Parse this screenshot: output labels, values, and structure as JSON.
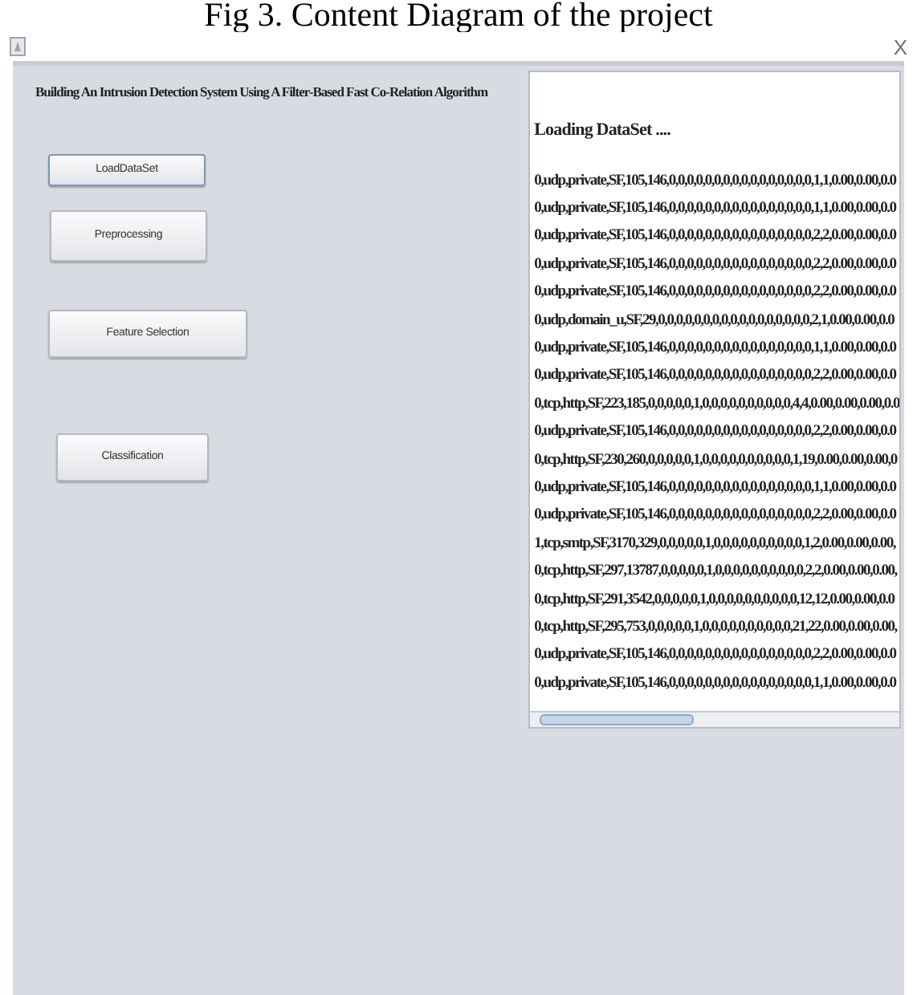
{
  "caption": "Fig 3. Content Diagram of the project",
  "window": {
    "close": "X"
  },
  "title": "Building An Intrusion Detection System Using A Filter-Based Fast Co-Relation Algorithm",
  "buttons": [
    {
      "label": "LoadDataSet",
      "selected": true
    },
    {
      "label": "Preprocessing",
      "selected": false
    },
    {
      "label": "Feature Selection",
      "selected": false
    },
    {
      "label": "Classification",
      "selected": false
    }
  ],
  "output": {
    "heading": "Loading DataSet ....",
    "lines": [
      "0,udp,private,SF,105,146,0,0,0,0,0,0,0,0,0,0,0,0,0,0,0,0,1,1,0.00,0.00,0.0",
      "0,udp,private,SF,105,146,0,0,0,0,0,0,0,0,0,0,0,0,0,0,0,0,1,1,0.00,0.00,0.0",
      "0,udp,private,SF,105,146,0,0,0,0,0,0,0,0,0,0,0,0,0,0,0,0,2,2,0.00,0.00,0.0",
      "0,udp,private,SF,105,146,0,0,0,0,0,0,0,0,0,0,0,0,0,0,0,0,2,2,0.00,0.00,0.0",
      "0,udp,private,SF,105,146,0,0,0,0,0,0,0,0,0,0,0,0,0,0,0,0,2,2,0.00,0.00,0.0",
      "0,udp,domain_u,SF,29,0,0,0,0,0,0,0,0,0,0,0,0,0,0,0,0,0,2,1,0.00,0.00,0.0",
      "0,udp,private,SF,105,146,0,0,0,0,0,0,0,0,0,0,0,0,0,0,0,0,1,1,0.00,0.00,0.0",
      "0,udp,private,SF,105,146,0,0,0,0,0,0,0,0,0,0,0,0,0,0,0,0,2,2,0.00,0.00,0.0",
      "0,tcp,http,SF,223,185,0,0,0,0,0,1,0,0,0,0,0,0,0,0,0,0,4,4,0.00,0.00,0.00,0.0",
      "0,udp,private,SF,105,146,0,0,0,0,0,0,0,0,0,0,0,0,0,0,0,0,2,2,0.00,0.00,0.0",
      "0,tcp,http,SF,230,260,0,0,0,0,0,1,0,0,0,0,0,0,0,0,0,0,1,19,0.00,0.00,0.00,0",
      "0,udp,private,SF,105,146,0,0,0,0,0,0,0,0,0,0,0,0,0,0,0,0,1,1,0.00,0.00,0.0",
      "0,udp,private,SF,105,146,0,0,0,0,0,0,0,0,0,0,0,0,0,0,0,0,2,2,0.00,0.00,0.0",
      "1,tcp,smtp,SF,3170,329,0,0,0,0,0,1,0,0,0,0,0,0,0,0,0,0,1,2,0.00,0.00,0.00,",
      "0,tcp,http,SF,297,13787,0,0,0,0,0,1,0,0,0,0,0,0,0,0,0,0,2,2,0.00,0.00,0.00,",
      "0,tcp,http,SF,291,3542,0,0,0,0,0,1,0,0,0,0,0,0,0,0,0,0,12,12,0.00,0.00,0.0",
      "0,tcp,http,SF,295,753,0,0,0,0,0,1,0,0,0,0,0,0,0,0,0,0,21,22,0.00,0.00,0.00,",
      "0,udp,private,SF,105,146,0,0,0,0,0,0,0,0,0,0,0,0,0,0,0,0,2,2,0.00,0.00,0.0",
      "0,udp,private,SF,105,146,0,0,0,0,0,0,0,0,0,0,0,0,0,0,0,0,1,1,0.00,0.00,0.0"
    ]
  }
}
